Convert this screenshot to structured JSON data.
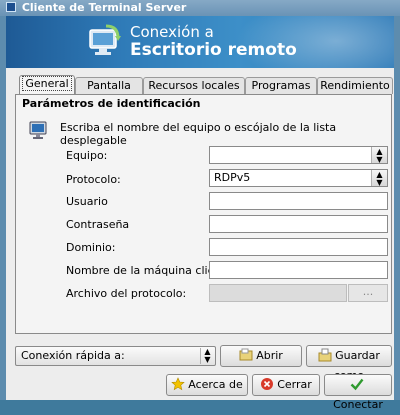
{
  "window": {
    "title": "Cliente de Terminal Server"
  },
  "banner": {
    "line1": "Conexión a",
    "line2": "Escritorio remoto"
  },
  "tabs": [
    {
      "label": "General",
      "active": true
    },
    {
      "label": "Pantalla",
      "active": false
    },
    {
      "label": "Recursos locales",
      "active": false
    },
    {
      "label": "Programas",
      "active": false
    },
    {
      "label": "Rendimiento",
      "active": false
    }
  ],
  "panel": {
    "section_title": "Parámetros de identificación",
    "instruction": "Escriba el nombre del equipo o escójalo de la lista desplegable",
    "fields": {
      "equipo_label": "Equipo:",
      "equipo_value": "",
      "protocolo_label": "Protocolo:",
      "protocolo_value": "RDPv5",
      "usuario_label": "Usuario",
      "contrasena_label": "Contraseña",
      "dominio_label": "Dominio:",
      "cliente_label": "Nombre de la máquina cliente:",
      "archivo_label": "Archivo del protocolo:",
      "archivo_button": "..."
    }
  },
  "footer": {
    "quick_label": "Conexión rápida a:",
    "abrir": "Abrir",
    "guardar": "Guardar como",
    "acerca": "Acerca de",
    "cerrar": "Cerrar",
    "conectar": "Conectar"
  },
  "colors": {
    "banner": "#2f7bb8",
    "window_border": "#5d8cae"
  }
}
